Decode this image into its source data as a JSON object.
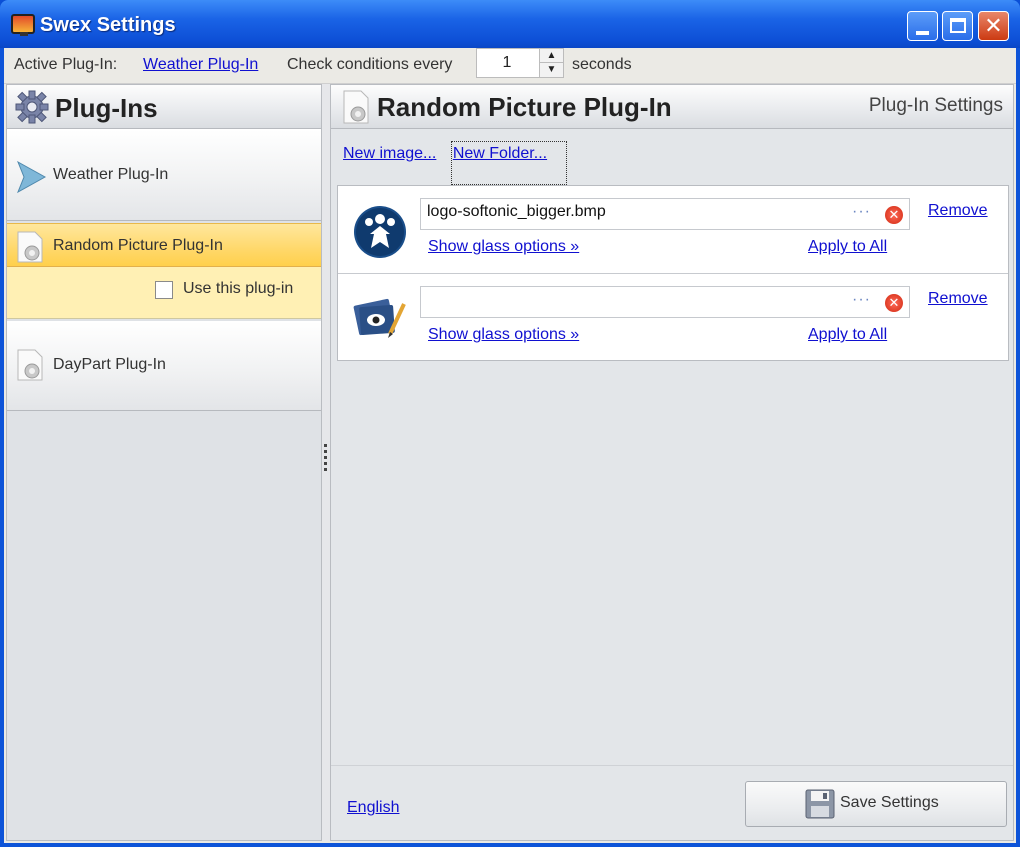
{
  "window": {
    "title": "Swex Settings",
    "controls": {
      "minimize": "",
      "maximize": "",
      "close": "✕"
    }
  },
  "toolbar": {
    "active_label": "Active Plug-In:",
    "active_link": "Weather Plug-In",
    "check_label": "Check conditions every",
    "interval_value": "1",
    "seconds_label": "seconds"
  },
  "left_panel": {
    "title": "Plug-Ins",
    "items": [
      {
        "label": "Weather Plug-In",
        "icon": "play-arrow-icon"
      },
      {
        "label": "Random Picture Plug-In",
        "icon": "gear-document-icon",
        "selected": true
      },
      {
        "label": "DayPart Plug-In",
        "icon": "gear-document-icon"
      }
    ],
    "use_plugin_label": "Use this plug-in",
    "use_plugin_checked": false
  },
  "right_panel": {
    "title": "Random Picture Plug-In",
    "subtitle": "Plug-In Settings",
    "new_image": "New image...",
    "new_folder": "New Folder...",
    "images": [
      {
        "path": "logo-softonic_bigger.bmp",
        "browse": "···",
        "remove": "Remove",
        "glass": "Show glass options »",
        "apply": "Apply to All",
        "thumb": "softonic-logo-icon"
      },
      {
        "path": "",
        "browse": "···",
        "remove": "Remove",
        "glass": "Show glass options »",
        "apply": "Apply to All",
        "thumb": "picture-pencil-icon"
      }
    ],
    "language": "English",
    "save": "Save Settings"
  },
  "colors": {
    "titlebar": "#1a63e6",
    "selected_item": "#ffd86a",
    "link": "#1010d0",
    "error_x": "#d0280f"
  }
}
